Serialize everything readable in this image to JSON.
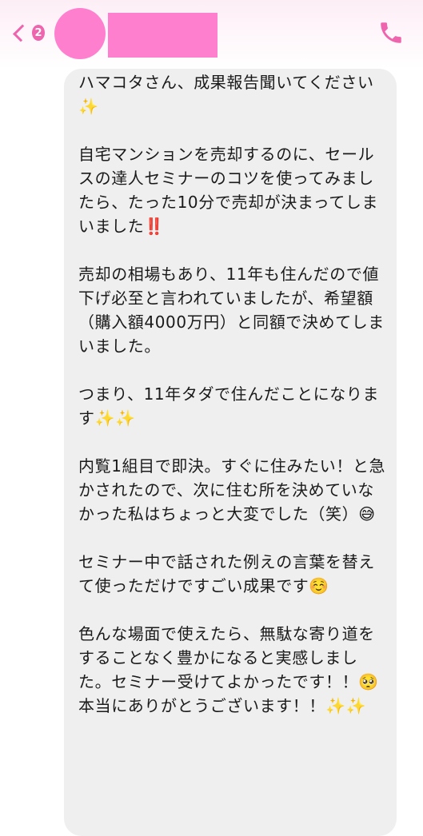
{
  "header": {
    "back_badge": "2",
    "accent_color": "#ee64ad",
    "avatar_color": "#ff7fcf",
    "icons": [
      "chevron-left-icon",
      "phone-icon"
    ]
  },
  "message": {
    "paragraphs": [
      "ハマコタさん、成果報告聞いてください✨",
      "自宅マンションを売却するのに、セールスの達人セミナーのコツを使ってみましたら、たった10分で売却が決まってしまいました‼️",
      "売却の相場もあり、11年も住んだので値下げ必至と言われていましたが、希望額（購入額4000万円）と同額で決めてしまいました。",
      "つまり、11年タダで住んだことになります✨✨",
      "内覧1組目で即決。すぐに住みたい！と急かされたので、次に住む所を決めていなかった私はちょっと大変でした（笑）😅",
      "セミナー中で話された例えの言葉を替えて使っただけですごい成果です☺️",
      "色んな場面で使えたら、無駄な寄り道をすることなく豊かになると実感しました。セミナー受けてよかったです！！🥺",
      "本当にありがとうございます！！✨✨"
    ],
    "bubble_color": "#efefef"
  }
}
